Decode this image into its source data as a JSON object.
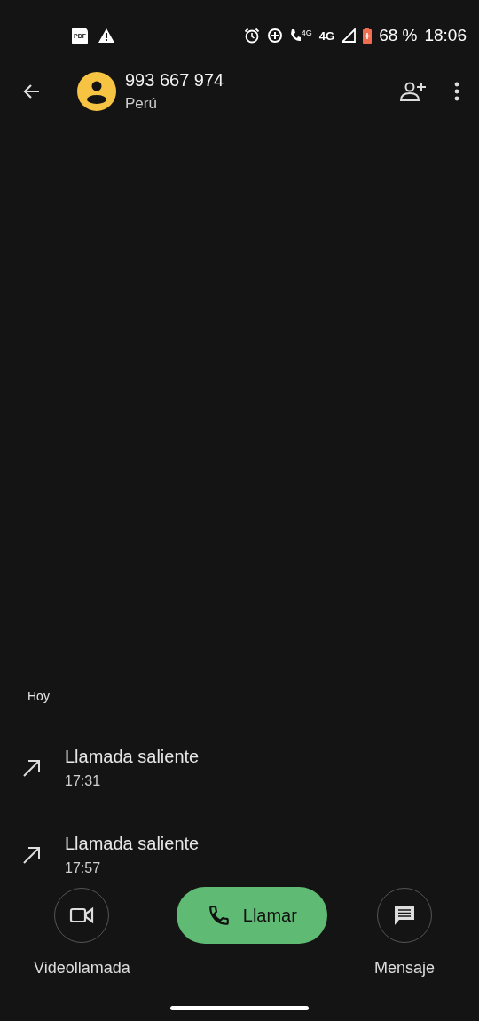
{
  "status_bar": {
    "pdf_label": "PDF",
    "call_network": "4G",
    "network": "4G",
    "battery": "68 %",
    "time": "18:06"
  },
  "contact": {
    "number": "993 667 974",
    "country": "Perú"
  },
  "history": {
    "date": "Hoy",
    "calls": [
      {
        "kind": "outgoing",
        "label": "Llamada saliente",
        "time": "17:31"
      },
      {
        "kind": "outgoing",
        "label": "Llamada saliente",
        "time": "17:57"
      }
    ]
  },
  "actions": {
    "video": "Videollamada",
    "call": "Llamar",
    "message": "Mensaje"
  }
}
